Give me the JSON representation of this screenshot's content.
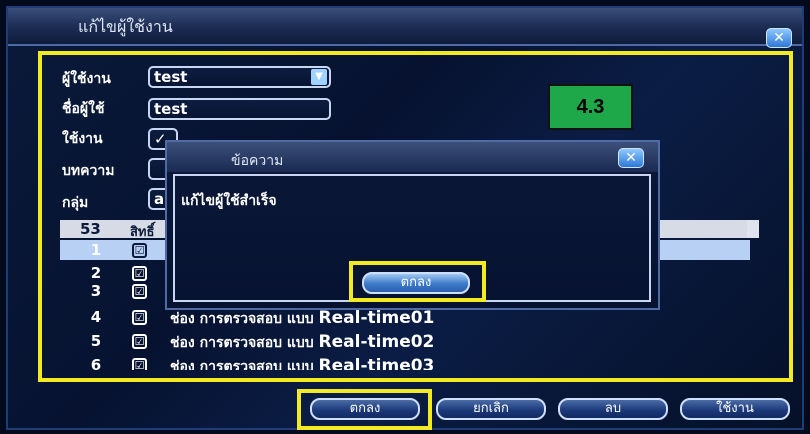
{
  "window": {
    "title": "แก้ไขผู้ใช้งาน",
    "close": "✕"
  },
  "form": {
    "user_label": "ผู้ใช้งาน",
    "user_value": "test",
    "user_dropdown": "▼",
    "name_label": "ชื่อผู้ใช้",
    "name_value": "test",
    "enable_label": "ใช้งาน",
    "enable_check": "✓",
    "memo_label": "บทความ",
    "group_label": "กลุ่ม",
    "group_value": "a"
  },
  "badge": "4.3",
  "table": {
    "count": "53",
    "header_right": "สิทธิ์",
    "rows": [
      {
        "num": "1",
        "check": "☑",
        "text": ""
      },
      {
        "num": "2",
        "check": "☑",
        "text": ""
      },
      {
        "num": "3",
        "check": "☑",
        "text": ""
      },
      {
        "num": "4",
        "check": "☑",
        "prefix": "ช่อง การตรวจสอบ แบบ",
        "mode": "Real-time01"
      },
      {
        "num": "5",
        "check": "☑",
        "prefix": "ช่อง การตรวจสอบ แบบ",
        "mode": "Real-time02"
      },
      {
        "num": "6",
        "check": "☑",
        "prefix": "ช่อง การตรวจสอบ แบบ",
        "mode": "Real-time03"
      }
    ]
  },
  "dialog": {
    "title": "ข้อความ",
    "message": "แก้ไขผู้ใช้สำเร็จ",
    "ok": "ตกลง",
    "close": "✕"
  },
  "buttons": {
    "ok": "ตกลง",
    "cancel": "ยกเลิก",
    "delete": "ลบ",
    "apply": "ใช้งาน"
  },
  "colors": {
    "highlight": "#f3ea22",
    "badge": "#1fa84a"
  }
}
